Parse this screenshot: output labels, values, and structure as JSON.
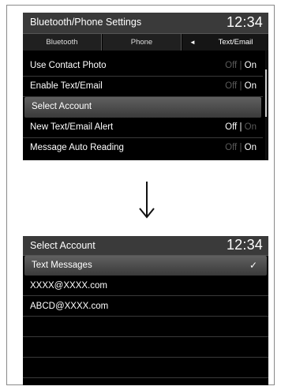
{
  "screen1": {
    "title": "Bluetooth/Phone Settings",
    "clock": "12:34",
    "tabs": [
      {
        "label": "Bluetooth"
      },
      {
        "label": "Phone"
      },
      {
        "label": "Text/Email",
        "arrow": "◄"
      }
    ],
    "rows": [
      {
        "label": "Use Contact Photo",
        "off": "Off",
        "sep": " | ",
        "on": "On",
        "active": "On"
      },
      {
        "label": "Enable Text/Email",
        "off": "Off",
        "sep": " | ",
        "on": "On",
        "active": "On"
      },
      {
        "label": "Select Account"
      },
      {
        "label": "New Text/Email Alert",
        "off": "Off",
        "sep": " | ",
        "on": "On",
        "active": "Off"
      },
      {
        "label": "Message Auto Reading",
        "off": "Off",
        "sep": " | ",
        "on": "On",
        "active": "On"
      }
    ],
    "selected_row": "Select Account",
    "scroll_position": 0.3
  },
  "screen2": {
    "title": "Select Account",
    "clock": "12:34",
    "items": [
      {
        "label": "Text Messages",
        "checked": true
      },
      {
        "label": "XXXX@XXXX.com"
      },
      {
        "label": "ABCD@XXXX.com"
      }
    ],
    "check_glyph": "✓"
  },
  "transition_icon": "down-arrow-icon",
  "colors": {
    "screen_bg": "#000000",
    "titlebar": "#3a3a3a",
    "selection": "#5a5a5a",
    "dim_text": "#5a5a5a"
  }
}
